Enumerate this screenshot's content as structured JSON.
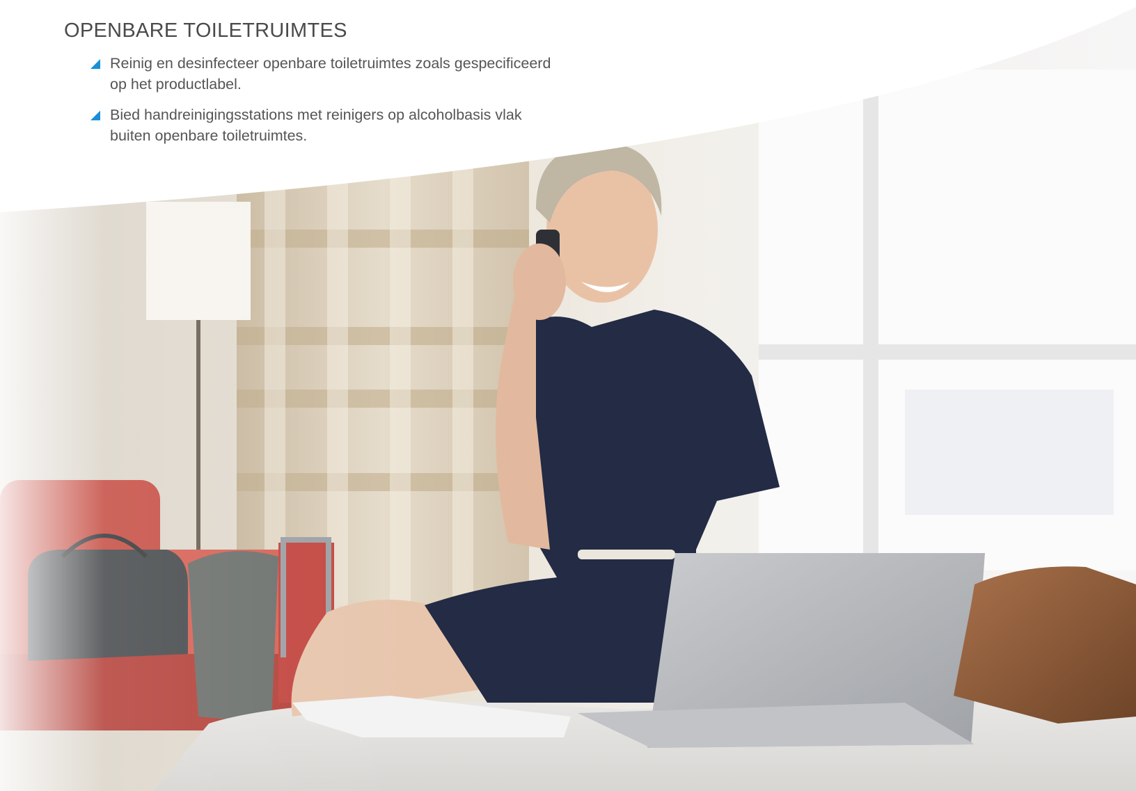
{
  "section": {
    "title": "OPENBARE TOILETRUIMTES",
    "bullets": [
      "Reinig en desinfecteer openbare toiletruimtes zoals gespecificeerd op het productlabel.",
      "Bied handreinigingsstations met reinigers op alcoholbasis vlak buiten openbare toiletruimtes."
    ]
  },
  "icons": {
    "bullet": "triangle-bullet-icon"
  },
  "colors": {
    "accent": "#1a8fd6",
    "heading": "#4a4a4a",
    "body_text": "#555555"
  }
}
